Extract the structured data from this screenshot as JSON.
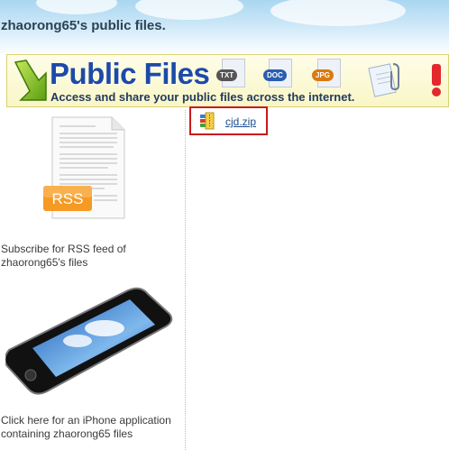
{
  "header": {
    "title": "zhaorong65's public files."
  },
  "banner": {
    "title": "Public Files",
    "subtitle": "Access and share your public files across the internet.",
    "file_types": [
      {
        "label": "TXT",
        "color": "#555555"
      },
      {
        "label": "DOC",
        "color": "#2a5db0"
      },
      {
        "label": "JPG",
        "color": "#d97a10"
      }
    ]
  },
  "sidebar": {
    "rss_badge": "RSS",
    "rss_link": "Subscribe for RSS feed of zhaorong65's files",
    "iphone_link": "Click here for an iPhone application containing zhaorong65 files"
  },
  "files": [
    {
      "name": "cjd.zip",
      "icon": "zip-archive-icon"
    }
  ],
  "colors": {
    "highlight_border": "#c8191e",
    "link": "#1a4b8c",
    "banner_title": "#1d4aa8"
  }
}
